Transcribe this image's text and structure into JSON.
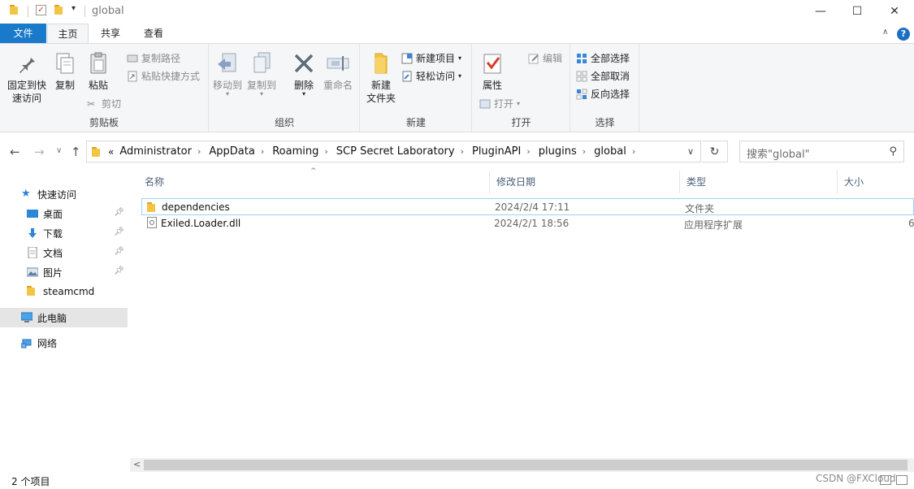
{
  "window": {
    "title": "global",
    "controls": {
      "minimize": "—",
      "maximize": "☐",
      "close": "✕"
    }
  },
  "ribbon_tabs": [
    "文件",
    "主页",
    "共享",
    "查看"
  ],
  "ribbon": {
    "clipboard": {
      "title": "剪贴板",
      "pin_quick_access_line1": "固定到快",
      "pin_quick_access_line2": "速访问",
      "copy": "复制",
      "paste": "粘贴",
      "copy_path": "复制路径",
      "paste_shortcut": "粘贴快捷方式",
      "cut": "剪切"
    },
    "organize": {
      "title": "组织",
      "move_to": "移动到",
      "copy_to": "复制到",
      "delete": "删除",
      "rename": "重命名"
    },
    "new": {
      "title": "新建",
      "new_folder_line1": "新建",
      "new_folder_line2": "文件夹",
      "new_item": "新建项目",
      "easy_access": "轻松访问"
    },
    "open": {
      "title": "打开",
      "properties": "属性",
      "open": "打开",
      "edit": "编辑"
    },
    "select": {
      "title": "选择",
      "select_all": "全部选择",
      "select_none": "全部取消",
      "invert": "反向选择"
    }
  },
  "address": {
    "overflow": "«",
    "crumbs": [
      "Administrator",
      "AppData",
      "Roaming",
      "SCP Secret Laboratory",
      "PluginAPI",
      "plugins",
      "global"
    ],
    "search_placeholder": "搜索\"global\""
  },
  "nav_pane": {
    "quick_access": "快速访问",
    "items": [
      "桌面",
      "下载",
      "文档",
      "图片",
      "steamcmd"
    ],
    "this_pc": "此电脑",
    "network": "网络"
  },
  "columns": [
    "名称",
    "修改日期",
    "类型",
    "大小"
  ],
  "files": [
    {
      "name": "dependencies",
      "date": "2024/2/4 17:11",
      "type": "文件夹",
      "size": "",
      "icon": "folder-icon"
    },
    {
      "name": "Exiled.Loader.dll",
      "date": "2024/2/1 18:56",
      "type": "应用程序扩展",
      "size": "6",
      "icon": "dll-file-icon"
    }
  ],
  "status": {
    "count": "2 个项目",
    "watermark": "CSDN @FXCloud"
  },
  "colors": {
    "accent": "#1979ca",
    "folder": "#f3c545",
    "selection": "#e5e5e5"
  }
}
